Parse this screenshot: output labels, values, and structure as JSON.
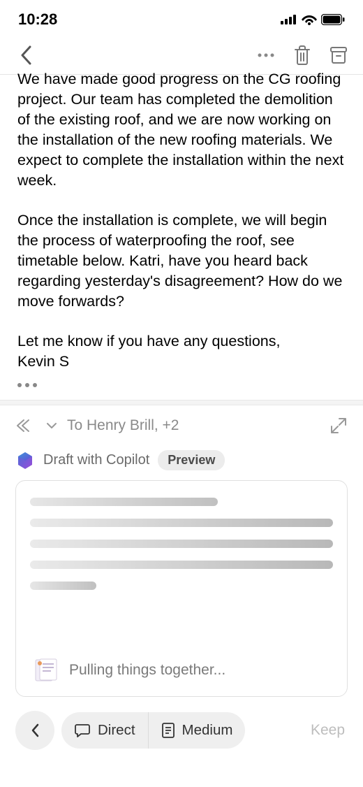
{
  "status": {
    "time": "10:28"
  },
  "email": {
    "para1": "We have made good progress on the CG roofing project. Our team has completed the demolition of the existing roof, and we are now working on the installation of the new roofing materials. We expect to complete the installation within the next week.",
    "para2": "Once the installation is complete, we will begin the process of waterproofing the roof, see timetable below. Katri, have you heard back regarding yesterday's disagreement? How do we move forwards?",
    "para3": "Let me know if you have any questions,",
    "signature": "Kevin S"
  },
  "reply": {
    "to": "To Henry Brill, +2"
  },
  "copilot": {
    "label": "Draft with Copilot",
    "badge": "Preview",
    "status": "Pulling things together..."
  },
  "bottom": {
    "direct": "Direct",
    "medium": "Medium",
    "keep": "Keep"
  }
}
